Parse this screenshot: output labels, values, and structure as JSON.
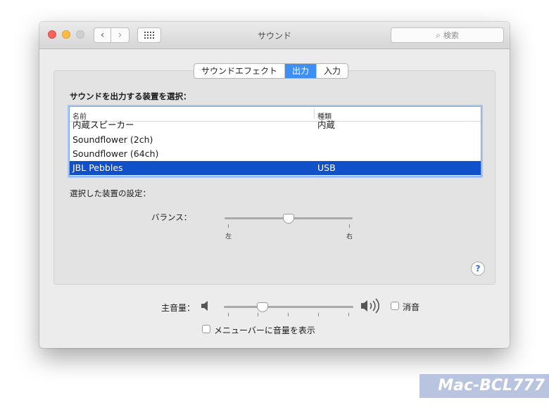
{
  "window": {
    "title": "サウンド",
    "search_placeholder": "検索",
    "icons": {
      "back": "chevron-left-icon",
      "forward": "chevron-right-icon",
      "grid": "grid-icon",
      "search": "magnifier-icon"
    }
  },
  "tabs": [
    {
      "label": "サウンドエフェクト",
      "active": false
    },
    {
      "label": "出力",
      "active": true
    },
    {
      "label": "入力",
      "active": false
    }
  ],
  "output": {
    "select_label": "サウンドを出力する装置を選択：",
    "columns": [
      "名前",
      "種類"
    ],
    "devices": [
      {
        "name": "内蔵スピーカー",
        "type": "内蔵",
        "selected": false
      },
      {
        "name": "Soundflower (2ch)",
        "type": "",
        "selected": false
      },
      {
        "name": "Soundflower (64ch)",
        "type": "",
        "selected": false
      },
      {
        "name": "JBL Pebbles",
        "type": "USB",
        "selected": true
      }
    ],
    "settings_label": "選択した装置の設定：",
    "balance_label": "バランス：",
    "balance_left": "左",
    "balance_right": "右",
    "balance_value": 0.5,
    "help_label": "?"
  },
  "volume": {
    "label": "主音量：",
    "level": 0.3,
    "mute_label": "消音",
    "muted": false,
    "menubar_label": "メニューバーに音量を表示",
    "show_in_menubar": false
  },
  "watermark": "Mac-BCL777",
  "colors": {
    "accent": "#3d8ff5",
    "selection": "#1050c8"
  }
}
